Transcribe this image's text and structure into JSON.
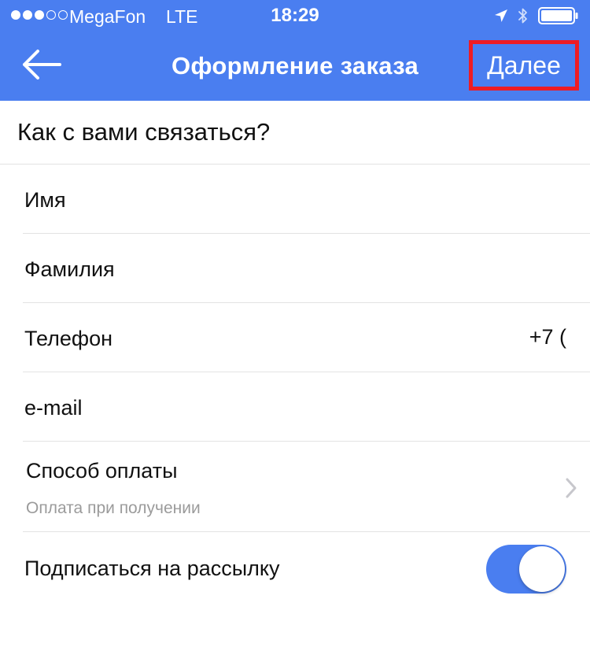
{
  "status_bar": {
    "carrier": "MegaFon",
    "network": "LTE",
    "time": "18:29",
    "signal_bars": 3,
    "signal_max": 5,
    "icons": [
      "location-arrow-icon",
      "bluetooth-icon",
      "battery-icon"
    ]
  },
  "nav": {
    "back_icon": "arrow-left-icon",
    "title": "Оформление заказа",
    "next_label": "Далее",
    "next_highlight_color": "#ee1c24"
  },
  "form": {
    "section_title": "Как с вами связаться?",
    "fields": {
      "first_name": "Имя",
      "last_name": "Фамилия",
      "phone": "Телефон",
      "phone_prefix": "+7 (",
      "email": "e-mail"
    },
    "payment": {
      "label": "Способ оплаты",
      "value": "Оплата при получении",
      "chevron_icon": "chevron-right-icon"
    },
    "subscribe": {
      "label": "Подписаться на рассылку",
      "enabled": true
    }
  },
  "colors": {
    "accent": "#4a7ef0",
    "divider": "#e3e3e3",
    "secondary_text": "#9b9b9b"
  }
}
